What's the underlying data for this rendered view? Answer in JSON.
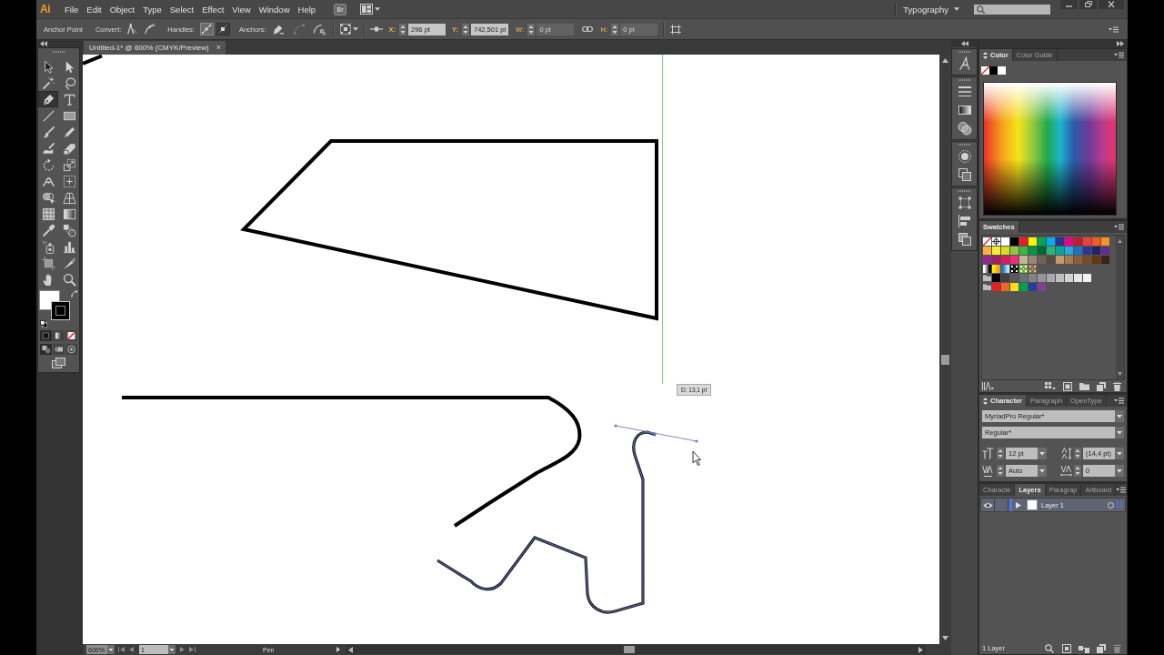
{
  "menu_bar": {
    "logo": "Ai",
    "items": [
      "File",
      "Edit",
      "Object",
      "Type",
      "Select",
      "Effect",
      "View",
      "Window",
      "Help"
    ],
    "bridge": "Br",
    "workspace": "Typography"
  },
  "control_bar": {
    "tool": "Anchor Point",
    "convert_label": "Convert:",
    "handles_label": "Handles:",
    "handle_buttons": [
      {
        "selected": true
      },
      {
        "selected": false
      }
    ],
    "anchors_label": "Anchors:",
    "anchor_buttons": [
      {
        "disabled": false
      },
      {
        "disabled": true
      },
      {
        "disabled": false
      }
    ],
    "fields": [
      {
        "label": "X:",
        "value": "296 pt",
        "disabled": false
      },
      {
        "label": "Y:",
        "value": "742,501 pt",
        "disabled": false
      },
      {
        "label": "W:",
        "value": "0 pt",
        "disabled": true
      },
      {
        "label": "H:",
        "value": "0 pt",
        "disabled": true
      }
    ]
  },
  "document_tab": {
    "title": "Untitled-1* @ 600% (CMYK/Preview)",
    "close": "×"
  },
  "tools": [
    {
      "kind": "selection",
      "selected": false
    },
    {
      "kind": "direct-selection",
      "selected": false
    },
    {
      "kind": "magic-wand",
      "selected": false
    },
    {
      "kind": "lasso",
      "selected": false
    },
    {
      "kind": "pen",
      "selected": true
    },
    {
      "kind": "type",
      "selected": false
    },
    {
      "kind": "line",
      "selected": false
    },
    {
      "kind": "rectangle",
      "selected": false
    },
    {
      "kind": "paintbrush",
      "selected": false
    },
    {
      "kind": "pencil",
      "selected": false
    },
    {
      "kind": "blob-brush",
      "selected": false
    },
    {
      "kind": "eraser",
      "selected": false
    },
    {
      "kind": "rotate",
      "selected": false
    },
    {
      "kind": "scale",
      "selected": false
    },
    {
      "kind": "width",
      "selected": false
    },
    {
      "kind": "free-transform",
      "selected": false
    },
    {
      "kind": "shape-builder",
      "selected": false
    },
    {
      "kind": "perspective-grid",
      "selected": false
    },
    {
      "kind": "mesh",
      "selected": false
    },
    {
      "kind": "gradient",
      "selected": false
    },
    {
      "kind": "eyedropper",
      "selected": false
    },
    {
      "kind": "blend",
      "selected": false
    },
    {
      "kind": "symbol-sprayer",
      "selected": false
    },
    {
      "kind": "column-graph",
      "selected": false
    },
    {
      "kind": "artboard",
      "selected": false
    },
    {
      "kind": "slice",
      "selected": false
    },
    {
      "kind": "hand",
      "selected": false
    },
    {
      "kind": "zoom",
      "selected": false
    }
  ],
  "color_boxes": [
    {
      "kind": "fill",
      "color": "#ffffff"
    },
    {
      "kind": "stroke",
      "color": "#000000"
    }
  ],
  "canvas": {
    "measurement": "D: 13,1 pt"
  },
  "status_bar": {
    "zoom": "600%",
    "artboard": "1",
    "current_tool": "Pen"
  },
  "color_panel": {
    "tabs": [
      {
        "label": "Color",
        "selected": true
      },
      {
        "label": "Color Guide",
        "selected": false
      }
    ],
    "quick_swatches": [
      {
        "kind": "none"
      },
      {
        "kind": "color",
        "color": "#000000"
      },
      {
        "kind": "color",
        "color": "#ffffff"
      }
    ]
  },
  "swatches_panel": {
    "tabs": [
      {
        "label": "Swatches",
        "selected": true
      }
    ],
    "rows": [
      [
        {
          "kind": "none"
        },
        {
          "kind": "registration"
        },
        {
          "kind": "color",
          "color": "#ffffff"
        },
        {
          "kind": "color",
          "color": "#000000"
        },
        {
          "kind": "color",
          "color": "#ed1c24"
        },
        {
          "kind": "color",
          "color": "#fff200"
        },
        {
          "kind": "color",
          "color": "#00a651"
        },
        {
          "kind": "color",
          "color": "#00aeef"
        },
        {
          "kind": "color",
          "color": "#2e3192"
        },
        {
          "kind": "color",
          "color": "#ec008c"
        },
        {
          "kind": "color",
          "color": "#be1e2d"
        },
        {
          "kind": "color",
          "color": "#ef4136"
        },
        {
          "kind": "color",
          "color": "#f15a29"
        },
        {
          "kind": "color",
          "color": "#f7941d"
        }
      ],
      [
        {
          "kind": "color",
          "color": "#fbb040"
        },
        {
          "kind": "color",
          "color": "#f9ed32"
        },
        {
          "kind": "color",
          "color": "#d7df23"
        },
        {
          "kind": "color",
          "color": "#8dc63f"
        },
        {
          "kind": "color",
          "color": "#39b54a"
        },
        {
          "kind": "color",
          "color": "#009444"
        },
        {
          "kind": "color",
          "color": "#006838"
        },
        {
          "kind": "color",
          "color": "#2bb673"
        },
        {
          "kind": "color",
          "color": "#00a79d"
        },
        {
          "kind": "color",
          "color": "#27aae1"
        },
        {
          "kind": "color",
          "color": "#1c75bc"
        },
        {
          "kind": "color",
          "color": "#2b3990"
        },
        {
          "kind": "color",
          "color": "#262262"
        },
        {
          "kind": "color",
          "color": "#662d91"
        }
      ],
      [
        {
          "kind": "color",
          "color": "#92278f"
        },
        {
          "kind": "color",
          "color": "#9e1f63"
        },
        {
          "kind": "color",
          "color": "#da1c5c"
        },
        {
          "kind": "color",
          "color": "#ee2a7b"
        },
        {
          "kind": "color",
          "color": "#c2b59b"
        },
        {
          "kind": "color",
          "color": "#9b8579"
        },
        {
          "kind": "color",
          "color": "#736357"
        },
        {
          "kind": "color",
          "color": "#594a42"
        },
        {
          "kind": "color",
          "color": "#c49a6c"
        },
        {
          "kind": "color",
          "color": "#a97c50"
        },
        {
          "kind": "color",
          "color": "#8b5e3c"
        },
        {
          "kind": "color",
          "color": "#754c29"
        },
        {
          "kind": "color",
          "color": "#603913"
        },
        {
          "kind": "color",
          "color": "#3c2415"
        }
      ],
      [
        {
          "kind": "gradient",
          "colors": [
            {
              "color": "#ffffff"
            },
            {
              "color": "#000000"
            }
          ]
        },
        {
          "kind": "gradient",
          "colors": [
            {
              "color": "#fff200"
            },
            {
              "color": "#f7941d"
            }
          ]
        },
        {
          "kind": "gradient",
          "colors": [
            {
              "color": "#1c75bc"
            },
            {
              "color": "#bfe6f8"
            }
          ]
        },
        {
          "kind": "pattern",
          "colors": [
            {
              "color": "#111111"
            },
            {
              "color": "#ffffff"
            }
          ]
        },
        {
          "kind": "pattern",
          "colors": [
            {
              "color": "#6fb53f"
            },
            {
              "color": "#ffffff"
            }
          ]
        },
        {
          "kind": "pattern",
          "colors": [
            {
              "color": "#8b6a4a"
            },
            {
              "color": "#d8c3a0"
            }
          ]
        }
      ],
      [
        {
          "kind": "folder"
        },
        {
          "kind": "color",
          "color": "#000000"
        },
        {
          "kind": "color",
          "color": "#414042"
        },
        {
          "kind": "color",
          "color": "#58595b"
        },
        {
          "kind": "color",
          "color": "#6d6e71"
        },
        {
          "kind": "color",
          "color": "#808285"
        },
        {
          "kind": "color",
          "color": "#939598"
        },
        {
          "kind": "color",
          "color": "#a7a9ac"
        },
        {
          "kind": "color",
          "color": "#bcbec0"
        },
        {
          "kind": "color",
          "color": "#d1d3d4"
        },
        {
          "kind": "color",
          "color": "#e6e7e8"
        },
        {
          "kind": "color",
          "color": "#f1f2f2"
        }
      ],
      [
        {
          "kind": "folder"
        },
        {
          "kind": "color",
          "color": "#ed1c24"
        },
        {
          "kind": "color",
          "color": "#f26522"
        },
        {
          "kind": "color",
          "color": "#ffde17"
        },
        {
          "kind": "color",
          "color": "#00a14b"
        },
        {
          "kind": "color",
          "color": "#21409a"
        },
        {
          "kind": "color",
          "color": "#7f3f98"
        }
      ]
    ]
  },
  "character_panel": {
    "tabs": [
      {
        "label": "Character",
        "selected": true
      },
      {
        "label": "Paragraph",
        "selected": false
      },
      {
        "label": "OpenType",
        "selected": false
      }
    ],
    "font_family": "MyriadPro Regular*",
    "font_style": "Regular*",
    "font_size": "12 pt",
    "leading": "(14,4 pt)",
    "kerning": "Auto",
    "tracking": "0"
  },
  "layers_panel": {
    "tabs": [
      {
        "label": "Characte",
        "selected": false
      },
      {
        "label": "Layers",
        "selected": true
      },
      {
        "label": "Paragrap",
        "selected": false
      },
      {
        "label": "Artboard",
        "selected": false
      }
    ],
    "layers": [
      {
        "name": "Layer 1",
        "selected": true,
        "visible": true,
        "expanded": false,
        "color": "#4a78e8"
      }
    ],
    "count": "1 Layer"
  }
}
